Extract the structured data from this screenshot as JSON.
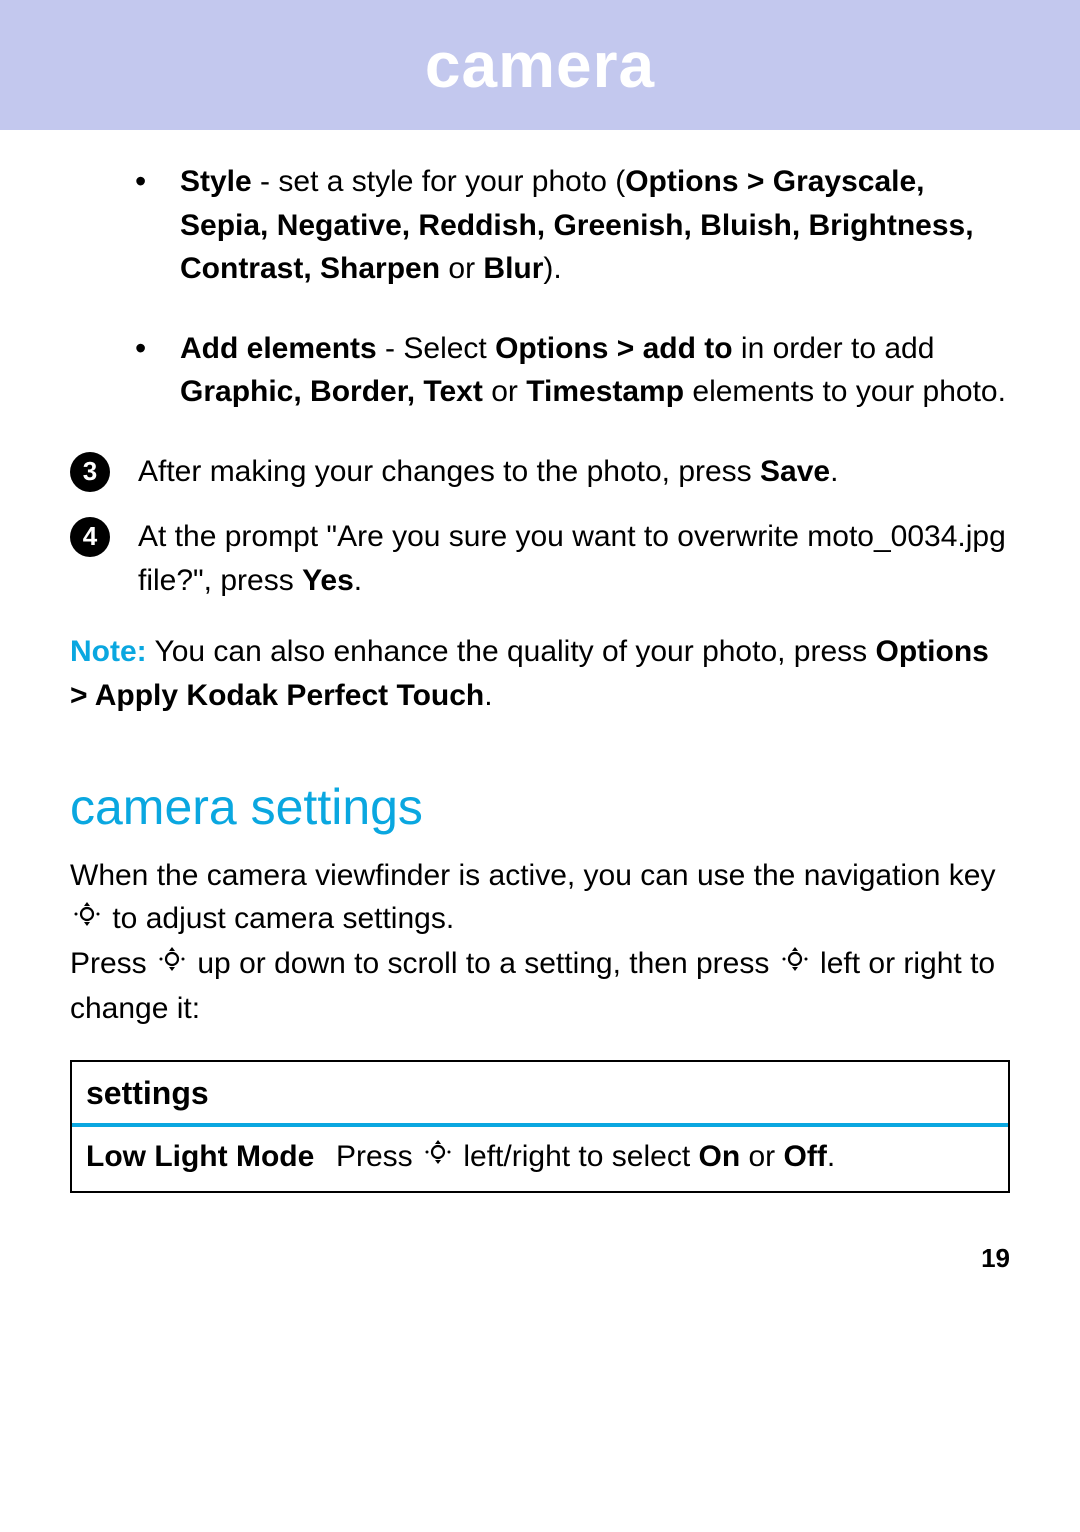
{
  "header": {
    "title": "camera"
  },
  "bullets": {
    "style": {
      "label": "Style",
      "text1": " - set a style for your photo (",
      "opt": "Options > Grayscale, Sepia, Negative, Reddish, Greenish, Bluish, Brightness, Contrast, Sharpen",
      "text2": " or ",
      "blur": "Blur",
      "text3": ")."
    },
    "add": {
      "label": "Add elements",
      "text1": " - Select ",
      "opt": "Options > add to",
      "text2": " in order to add ",
      "elems": "Graphic, Border, Text",
      "text3": " or ",
      "ts": "Timestamp",
      "text4": " elements to your photo."
    }
  },
  "steps": {
    "s3": {
      "num": "3",
      "text1": "After making your changes to the photo, press ",
      "save": "Save",
      "dot": "."
    },
    "s4": {
      "num": "4",
      "text1": "At the prompt \"Are you sure you want to overwrite moto_0034.jpg file?\", press ",
      "yes": "Yes",
      "dot": "."
    }
  },
  "note": {
    "label": "Note:",
    "text1": " You can also enhance the quality of your photo, press ",
    "opt": "Options > Apply Kodak Perfect Touch",
    "dot": "."
  },
  "section": {
    "heading": "camera settings",
    "p1a": "When the camera viewfinder is active, you can use the navigation key ",
    "p1b": " to adjust camera settings.",
    "p2a": "Press ",
    "p2b": " up or down to scroll to a setting, then press ",
    "p2c": " left or right to change it:"
  },
  "table": {
    "header": "settings",
    "row1": {
      "label": "Low Light Mode",
      "t1": "Press ",
      "t2": " left/right to select ",
      "on": "On",
      "t3": " or ",
      "off": "Off",
      "dot": "."
    }
  },
  "page_number": "19"
}
